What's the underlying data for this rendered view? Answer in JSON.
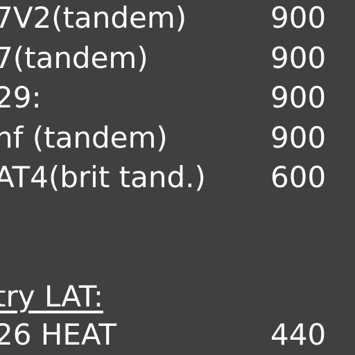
{
  "rows": [
    {
      "label": "7V2(tandem)",
      "value": "900"
    },
    {
      "label": "7(tandem)",
      "value": "900"
    },
    {
      "label": "29:",
      "value": "900"
    },
    {
      "label": "nf (tandem)",
      "value": "900"
    },
    {
      "label": " AT4(brit tand.)",
      "value": "600"
    }
  ],
  "section": {
    "label": "try LAT:"
  },
  "bottom_row": {
    "label": "26 HEAT",
    "value": "440"
  },
  "colors": {
    "background": "#404040",
    "text": "#ffffff"
  }
}
